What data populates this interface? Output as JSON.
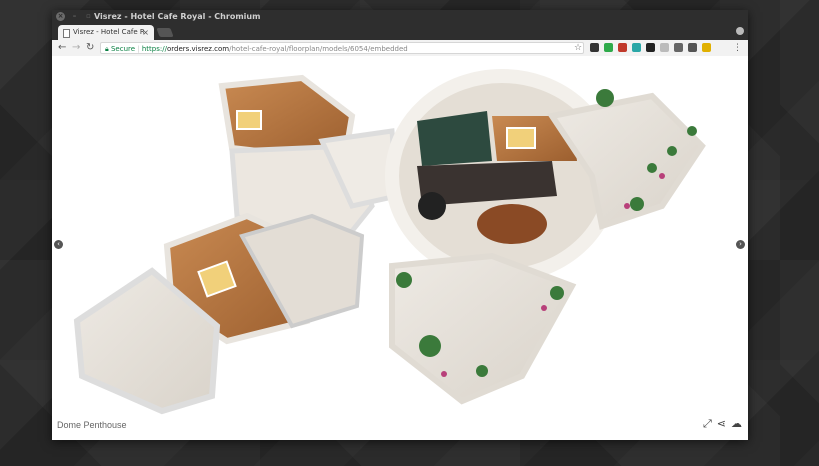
{
  "window": {
    "title": "Visrez - Hotel Cafe Royal - Chromium"
  },
  "tab": {
    "label": "Visrez - Hotel Cafe R",
    "close_glyph": "×"
  },
  "toolbar": {
    "back_glyph": "←",
    "forward_glyph": "→",
    "reload_glyph": "↻",
    "secure_label": "Secure",
    "url_scheme": "https://",
    "url_host": "orders.visrez.com",
    "url_path": "/hotel-cafe-royal/floorplan/models/6054/embedded",
    "star_glyph": "☆",
    "menu_glyph": "⋮"
  },
  "viewer": {
    "caption": "Dome Penthouse",
    "prev_glyph": "‹",
    "next_glyph": "›",
    "fullscreen_glyph": "⤢",
    "share_glyph": "⋖",
    "download_glyph": "☁"
  },
  "extensions": [
    {
      "name": "ext-1",
      "color": "#333333"
    },
    {
      "name": "ext-2",
      "color": "#2eaa4a"
    },
    {
      "name": "ext-3",
      "color": "#c0392b"
    },
    {
      "name": "ext-4",
      "color": "#2aa7a7"
    },
    {
      "name": "ext-5",
      "color": "#222222"
    },
    {
      "name": "ext-6",
      "color": "#bbbbbb"
    },
    {
      "name": "ext-7",
      "color": "#666666"
    },
    {
      "name": "ext-8",
      "color": "#555555"
    },
    {
      "name": "ext-9",
      "color": "#e0b000"
    }
  ]
}
